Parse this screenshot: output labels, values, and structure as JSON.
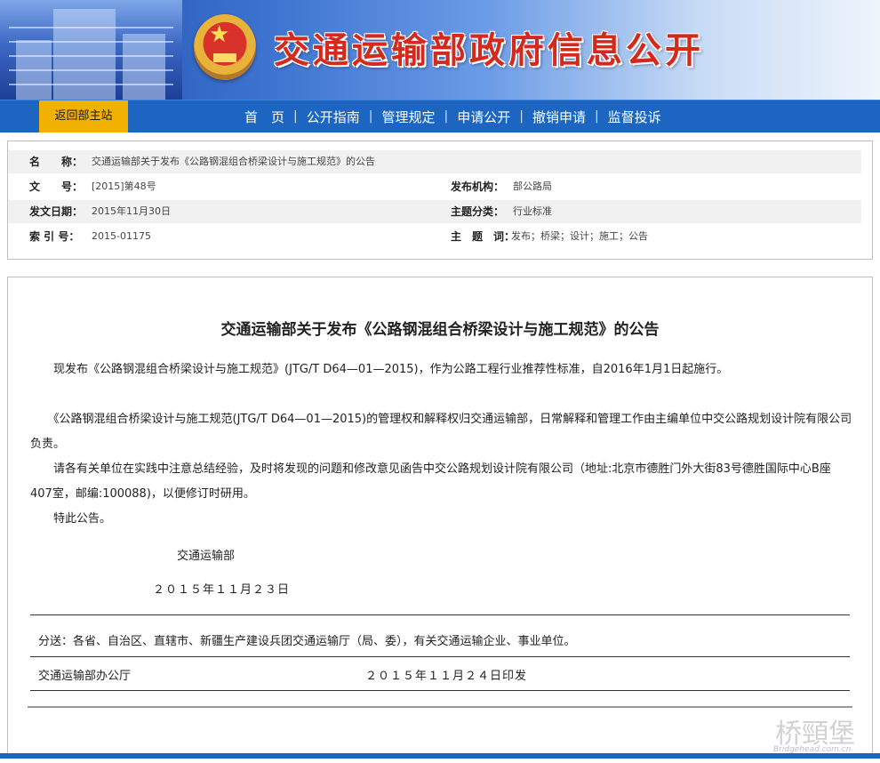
{
  "banner": {
    "title": "交通运输部政府信息公开"
  },
  "nav": {
    "home_button": "返回部主站",
    "links": [
      "首　页",
      "公开指南",
      "管理规定",
      "申请公开",
      "撤销申请",
      "监督投诉"
    ]
  },
  "info": {
    "name_label": "名　　称：",
    "name_value": "交通运输部关于发布《公路钢混组合桥梁设计与施工规范》的公告",
    "docno_label": "文　　号：",
    "docno_value": "[2015]第48号",
    "agency_label": "发布机构：",
    "agency_value": "部公路局",
    "date_label": "发文日期：",
    "date_value": "2015年11月30日",
    "category_label": "主题分类：",
    "category_value": "行业标准",
    "index_label": "索 引 号：",
    "index_value": "2015-01175",
    "keywords_label": "主　题　词：",
    "keywords_value": "发布；桥梁；设计；施工；公告"
  },
  "doc": {
    "title": "交通运输部关于发布《公路钢混组合桥梁设计与施工规范》的公告",
    "p1": "　　现发布《公路钢混组合桥梁设计与施工规范》(JTG/T D64—01—2015)，作为公路工程行业推荐性标准，自2016年1月1日起施行。",
    "p2": "　　《公路钢混组合桥梁设计与施工规范(JTG/T D64—01—2015)的管理权和解释权归交通运输部，日常解释和管理工作由主编单位中交公路规划设计院有限公司负责。",
    "p3": "　　请各有关单位在实践中注意总结经验，及时将发现的问题和修改意见函告中交公路规划设计院有限公司（地址:北京市德胜门外大街83号德胜国际中心B座407室，邮编:100088)，以便修订时研用。",
    "p4": "　　特此公告。",
    "signer": "交通运输部",
    "sign_date": "２０１５年１１月２３日",
    "distribution": "分送：各省、自治区、直辖市、新疆生产建设兵团交通运输厅（局、委），有关交通运输企业、事业单位。",
    "office": "交通运输部办公厅",
    "issue_date": "２０１５年１１月２４日印发"
  },
  "watermark": {
    "text": "桥頸堡",
    "url": "Bridgehead.com.cn"
  }
}
